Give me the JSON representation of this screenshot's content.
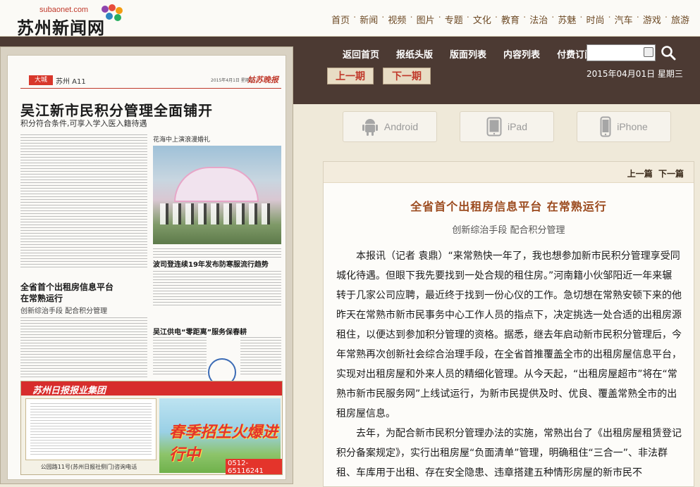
{
  "site": {
    "logo_sub": "subaonet.com",
    "logo_main": "苏州新闻网",
    "nav": [
      "首页",
      "新闻",
      "视频",
      "图片",
      "专题",
      "文化",
      "教育",
      "法治",
      "苏魅",
      "时尚",
      "汽车",
      "游戏",
      "旅游"
    ]
  },
  "band": {
    "links": [
      "返回首页",
      "报纸头版",
      "版面列表",
      "内容列表",
      "付费订阅"
    ],
    "search_value": "",
    "prev_issue": "上一期",
    "next_issue": "下一期",
    "date": "2015年04月01日 星期三"
  },
  "devices": [
    {
      "label": "Android",
      "icon": "android-icon"
    },
    {
      "label": "iPad",
      "icon": "tablet-icon"
    },
    {
      "label": "iPhone",
      "icon": "phone-icon"
    }
  ],
  "paper": {
    "tag": "大城",
    "section": "苏州 A11",
    "masthead": "姑苏晚报",
    "date": "2015年4月1日 星期三",
    "headline": "吴江新市民积分管理全面铺开",
    "subhead": "积分符合条件,可享入学入医入籍待遇",
    "article2_title_1": "全省首个出租房信息平台",
    "article2_title_2": "在常熟运行",
    "article2_sub": "创新综治手段 配合积分管理",
    "photo_caption": "花海中上演浪漫婚礼",
    "article3_title": "波司登连续19年发布防寒服流行趋势",
    "article4_title": "吴江供电“零距离”服务保春耕",
    "ad_title": "苏州日报报业集团",
    "ad_right_title": "春季招生火爆进行中",
    "ad_phone": "0512-65116241",
    "ad_address": "公园路11号(苏州日报社侧门)咨询电话"
  },
  "article": {
    "prev": "上一篇",
    "next": "下一篇",
    "title": "全省首个出租房信息平台  在常熟运行",
    "subtitle": "创新综治手段  配合积分管理",
    "paragraphs": [
      "本报讯（记者  袁鼎）“来常熟快一年了，我也想参加新市民积分管理享受同城化待遇。但眼下我先要找到一处合规的租住房。”河南籍小伙邹阳近一年来辗转于几家公司应聘，最近终于找到一份心仪的工作。急切想在常熟安顿下来的他昨天在常熟市新市民事务中心工作人员的指点下，决定挑选一处合适的出租房源租住，以便达到参加积分管理的资格。据悉，继去年启动新市民积分管理后，今年常熟再次创新社会综合治理手段，在全省首推覆盖全市的出租房屋信息平台，实现对出租房屋和外来人员的精细化管理。从今天起，“出租房屋超市”将在“常熟市新市民服务网”上线试运行，为新市民提供及时、优良、覆盖常熟全市的出租房屋信息。",
      "去年，为配合新市民积分管理办法的实施，常熟出台了《出租房屋租赁登记积分备案规定》，实行出租房屋“负面清单”管理，明确租住“三合一”、非法群租、车库用于出租、存在安全隐患、违章搭建五种情形房屋的新市民不"
    ]
  }
}
